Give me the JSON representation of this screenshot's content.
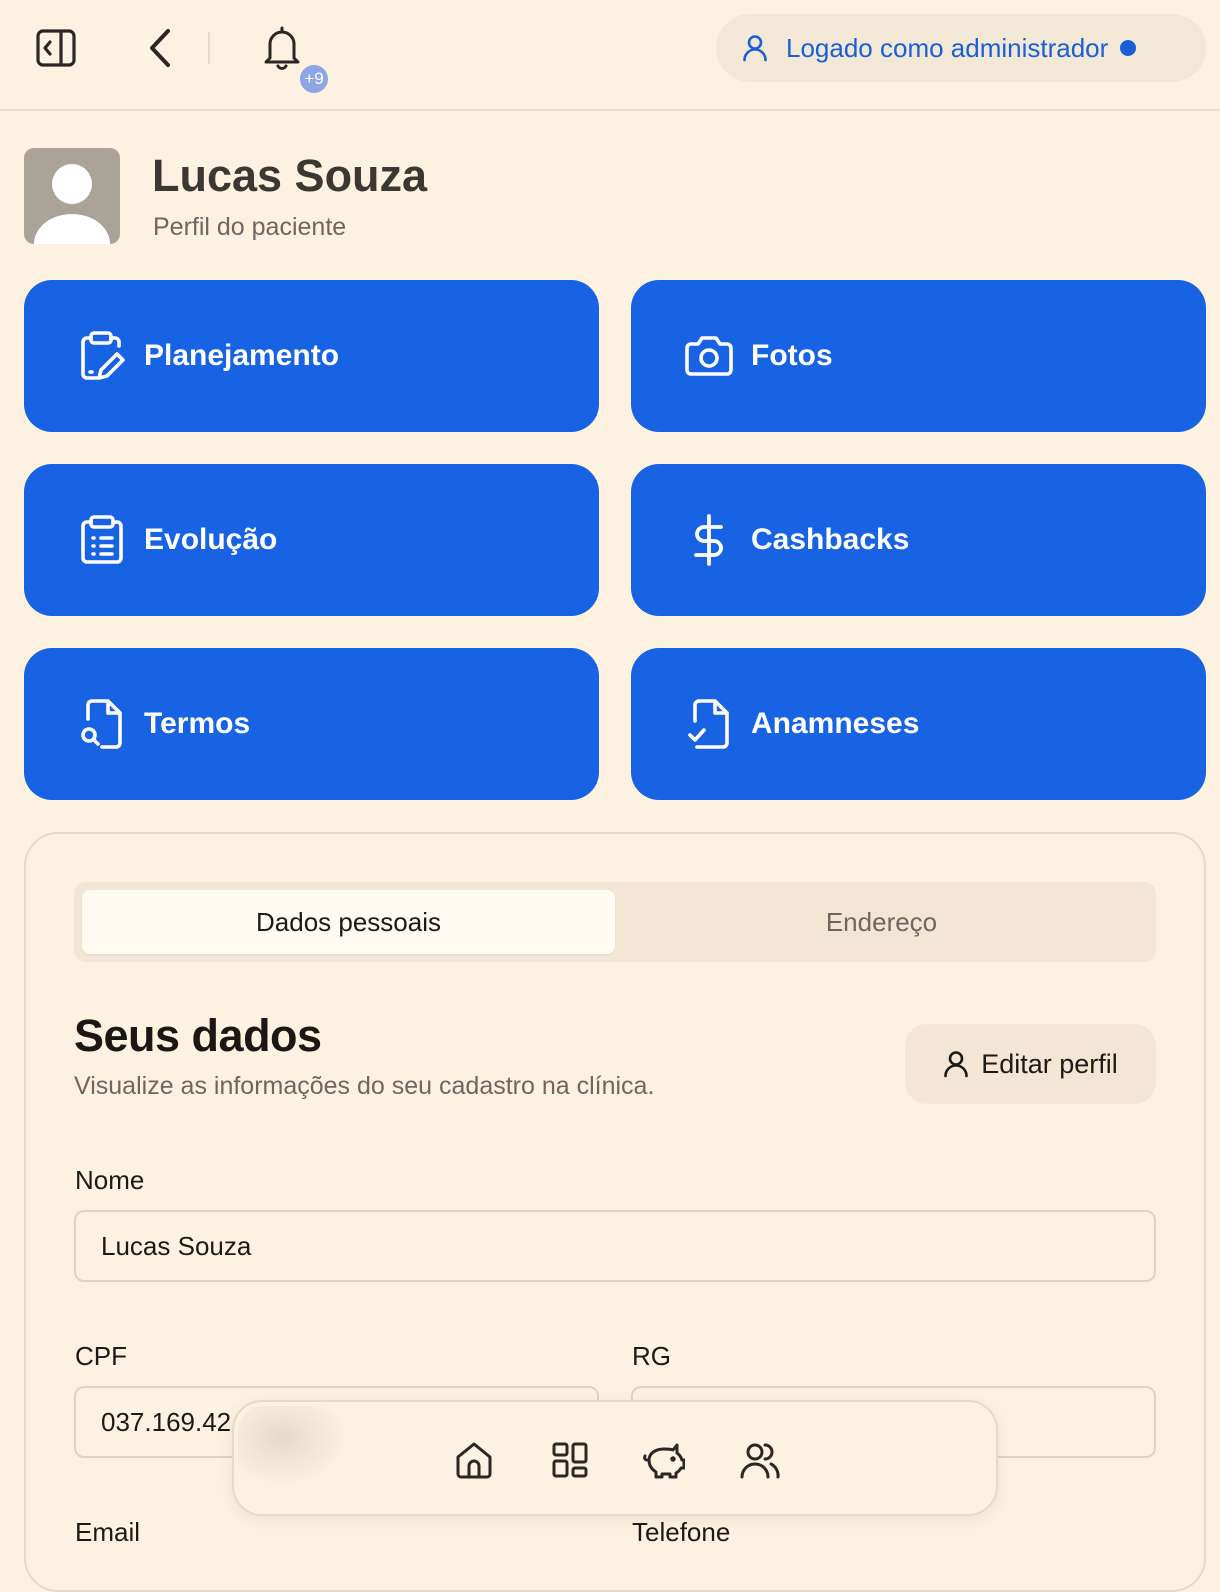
{
  "header": {
    "notifications_badge": "+9",
    "admin_status": "Logado como administrador",
    "accent_color": "#1a5fd8"
  },
  "patient": {
    "name": "Lucas Souza",
    "subtitle": "Perfil do paciente"
  },
  "actions": [
    {
      "label": "Planejamento",
      "icon": "clipboard-edit-icon"
    },
    {
      "label": "Fotos",
      "icon": "camera-icon"
    },
    {
      "label": "Evolução",
      "icon": "clipboard-list-icon"
    },
    {
      "label": "Cashbacks",
      "icon": "dollar-icon"
    },
    {
      "label": "Termos",
      "icon": "file-search-icon"
    },
    {
      "label": "Anamneses",
      "icon": "file-check-icon"
    }
  ],
  "tabs": [
    {
      "label": "Dados pessoais",
      "active": true
    },
    {
      "label": "Endereço",
      "active": false
    }
  ],
  "section": {
    "title": "Seus dados",
    "subtitle": "Visualize as informações do seu cadastro na clínica.",
    "edit_label": "Editar perfil"
  },
  "fields": {
    "nome_label": "Nome",
    "nome_value": "Lucas Souza",
    "cpf_label": "CPF",
    "cpf_value": "037.169.42",
    "rg_label": "RG",
    "rg_value": "",
    "email_label": "Email",
    "telefone_label": "Telefone"
  },
  "bottom_nav": [
    "home-icon",
    "apps-grid-icon",
    "piggy-bank-icon",
    "users-icon"
  ],
  "colors": {
    "background": "#fdf1e1",
    "card": "#1763e3",
    "muted_surface": "#f3e6d5"
  }
}
